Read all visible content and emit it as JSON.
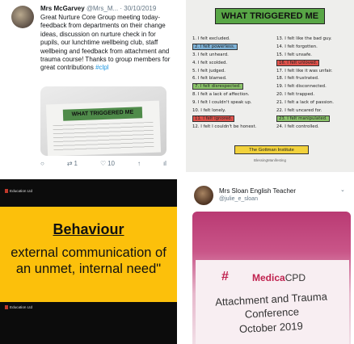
{
  "tweet": {
    "author": "Mrs McGarvey",
    "handle": "@Mrs_M...",
    "date": "30/10/2019",
    "text": "Great Nurture Core Group meeting today- feedback from departments on their change ideas, discussion on nurture check in for pupils, our lunchtime wellbeing club, staff wellbeing and feedback from attachment and trauma course! Thanks to group members for great contributions",
    "hashtag": "#clpl",
    "photo_title": "WHAT TRIGGERED ME",
    "actions": {
      "retweets": "1",
      "likes": "10"
    }
  },
  "worksheet": {
    "title": "WHAT TRIGGERED ME",
    "left_items": [
      "1. I felt excluded.",
      "2. I felt powerless.",
      "3. I felt unheard.",
      "4. I felt scolded.",
      "5. I felt judged.",
      "6. I felt blamed.",
      "7. I felt disrespected.",
      "8. I felt a lack of affection.",
      "9. I felt I couldn't speak up.",
      "10. I felt lonely.",
      "11. I felt ignored.",
      "12. I felt I couldn't be honest."
    ],
    "right_items": [
      "13. I felt like the bad guy.",
      "14. I felt forgotten.",
      "15. I felt unsafe.",
      "16. I felt unloved.",
      "17. I felt like it was unfair.",
      "18. I felt frustrated.",
      "19. I felt disconnected.",
      "20. I felt trapped.",
      "21. I felt a lack of passion.",
      "22. I felt uncared for.",
      "23. I felt manipulated.",
      "24. I felt controlled."
    ],
    "footer": "The Gottman Institute",
    "credit": "BlessingManifesting",
    "colors": {
      "title_bg": "#58a646",
      "highlight_blue": "#7fb3d8",
      "highlight_green": "#8cc56b",
      "highlight_red": "#e0524b",
      "highlight_orange": "#f29a3a",
      "footer_bg": "#f2d23c"
    }
  },
  "slide": {
    "bar_label": "Education Ltd",
    "heading": "Behaviour",
    "quote": "external communication of an unmet, internal need\"",
    "colors": {
      "panel": "#fcc00b",
      "frame": "#0c0c0c"
    }
  },
  "teacher_tweet": {
    "name": "Mrs Sloan English Teacher",
    "handle": "@julie_e_sloan",
    "brand_prefix": "Medica",
    "brand_suffix": "CPD",
    "conference": "Attachment and Trauma Conference",
    "date_fragment": "October 2019",
    "colors": {
      "brand": "#c0224f"
    }
  }
}
